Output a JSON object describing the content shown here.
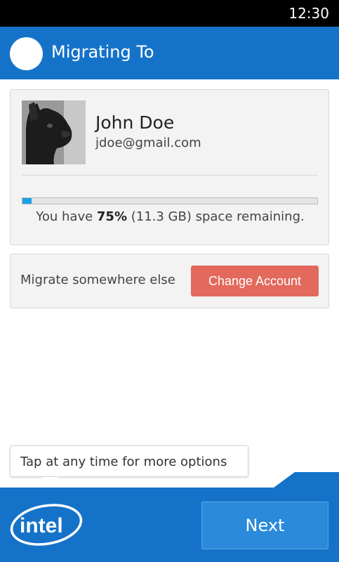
{
  "status_bar": {
    "time": "12:30"
  },
  "app_bar": {
    "title": "Migrating To",
    "icon": "app-circle-icon"
  },
  "account": {
    "name": "John Doe",
    "email": "jdoe@gmail.com",
    "avatar": "bulldog-avatar",
    "space": {
      "prefix": "You have ",
      "percent": "75%",
      "suffix": " (11.3 GB) space remaining.",
      "bar_fill_fraction": 0.03
    }
  },
  "migrate": {
    "label": "Migrate somewhere else",
    "button_label": "Change Account"
  },
  "tooltip": {
    "text": "Tap at any time for more options"
  },
  "footer": {
    "logo_text": "intel",
    "next_label": "Next"
  },
  "colors": {
    "brand_blue": "#1473c9",
    "button_red": "#e3695d",
    "progress_blue": "#1aa0e6"
  }
}
